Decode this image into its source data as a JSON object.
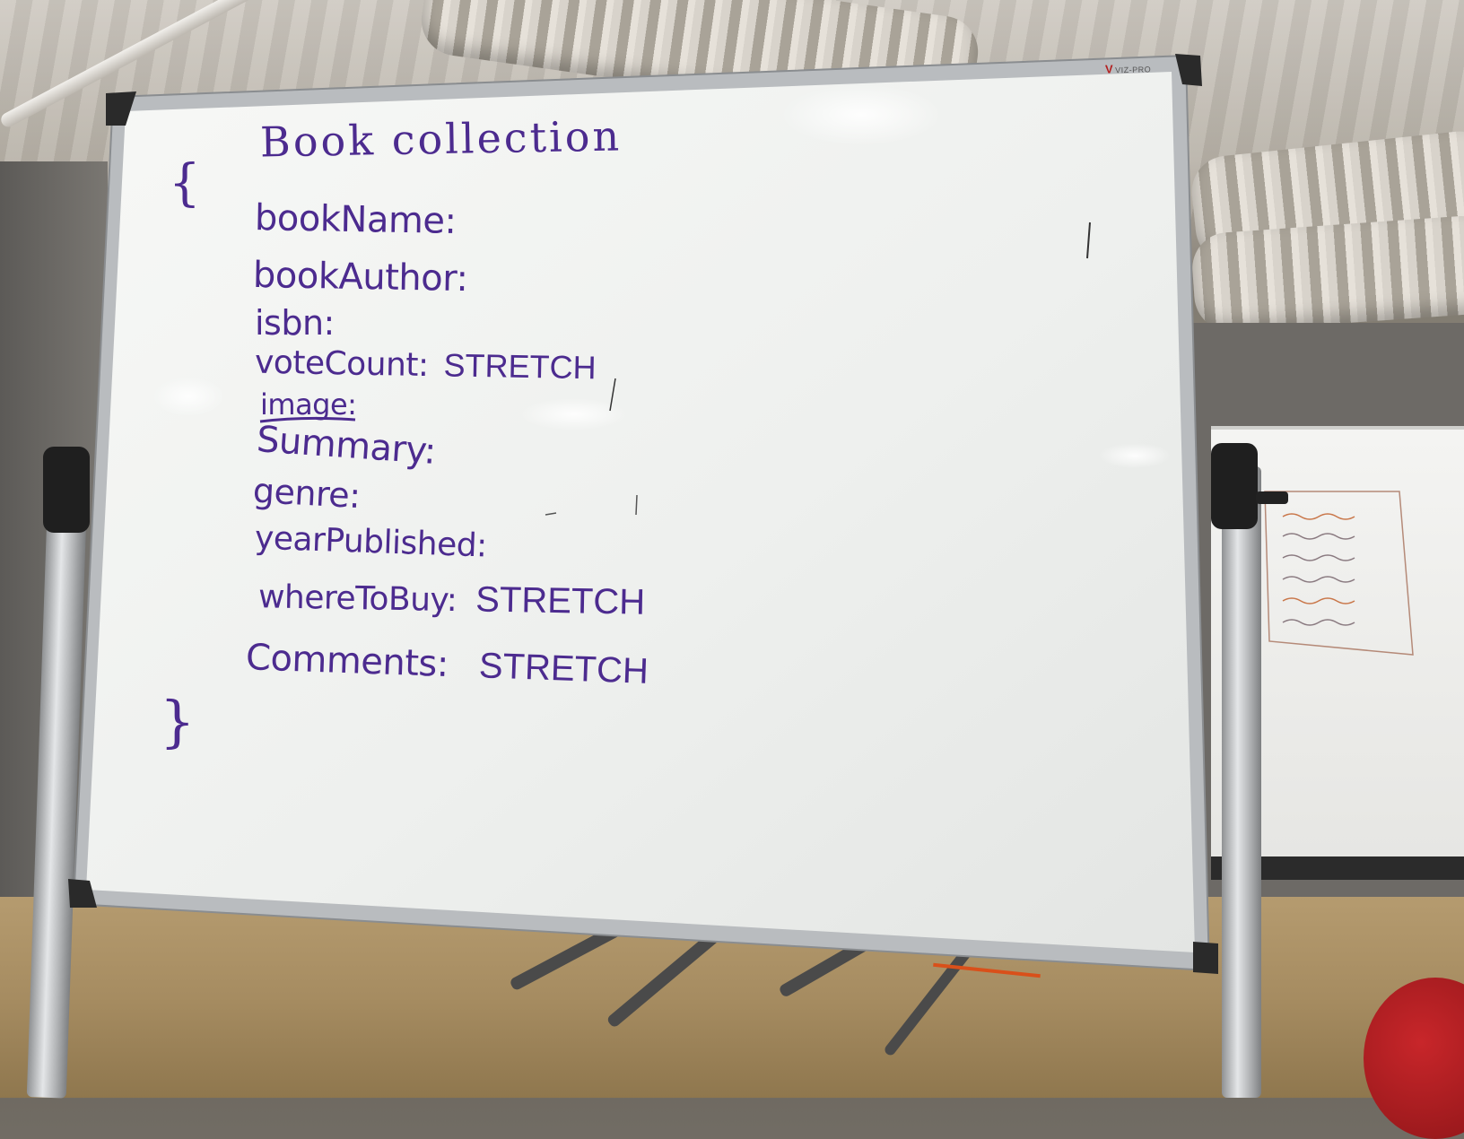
{
  "whiteboard": {
    "brand": "VIZ-PRO",
    "title": "Book collection",
    "open_brace": "{",
    "close_brace": "}",
    "fields": [
      {
        "name": "bookName:",
        "note": ""
      },
      {
        "name": "bookAuthor:",
        "note": ""
      },
      {
        "name": "isbn:",
        "note": ""
      },
      {
        "name": "voteCount:",
        "note": "STRETCH"
      },
      {
        "name": "image:",
        "note": ""
      },
      {
        "name": "Summary:",
        "note": ""
      },
      {
        "name": "genre:",
        "note": ""
      },
      {
        "name": "yearPublished:",
        "note": ""
      },
      {
        "name": "whereToBuy:",
        "note": "STRETCH"
      },
      {
        "name": "Comments:",
        "note": "STRETCH"
      }
    ]
  },
  "colors": {
    "marker": "#4c2b8f",
    "board_surface": "#f3f4f2",
    "board_frame": "#b9bcbf"
  }
}
